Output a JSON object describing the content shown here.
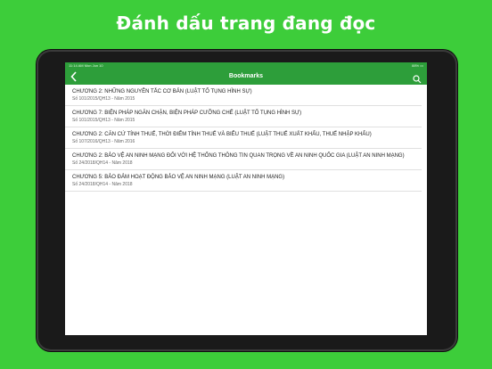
{
  "promo": {
    "title": "Đánh dấu trang đang đọc"
  },
  "status": {
    "left": "11:14 AM   Mon Jun 10",
    "right": "88% ▭"
  },
  "nav": {
    "title": "Bookmarks",
    "back_icon": "chevron-left-icon",
    "search_icon": "search-icon"
  },
  "colors": {
    "background": "#3dcd3a",
    "nav": "#2d9e3a"
  },
  "bookmarks": [
    {
      "title": "CHƯƠNG 2: NHỮNG NGUYÊN TẮC CƠ BẢN (LUẬT TỐ TỤNG HÌNH SỰ)",
      "sub": "Số 101/2015/QH13 - Năm 2015"
    },
    {
      "title": "CHƯƠNG 7: BIỆN PHÁP NGĂN CHẶN, BIỆN PHÁP CƯỠNG CHẾ (LUẬT TỐ TỤNG HÌNH SỰ)",
      "sub": "Số 101/2015/QH13 - Năm 2015"
    },
    {
      "title": "CHƯƠNG 2: CĂN CỨ TÍNH THUẾ, THỜI ĐIỂM TÍNH THUẾ VÀ BIỂU THUẾ (LUẬT THUẾ XUẤT KHẨU, THUẾ NHẬP KHẨU)",
      "sub": "Số 107/2016/QH13 - Năm 2016"
    },
    {
      "title": "CHƯƠNG 2: BẢO VỆ AN NINH MẠNG ĐỐI VỚI HỆ THỐNG THÔNG TIN QUAN TRỌNG VỀ AN NINH QUỐC GIA (LUẬT AN NINH MẠNG)",
      "sub": "Số 24/2018/QH14 - Năm 2018"
    },
    {
      "title": "CHƯƠNG 5: BẢO ĐẢM HOẠT ĐỘNG BẢO VỆ AN NINH MẠNG (LUẬT AN NINH MẠNG)",
      "sub": "Số 24/2018/QH14 - Năm 2018"
    }
  ]
}
